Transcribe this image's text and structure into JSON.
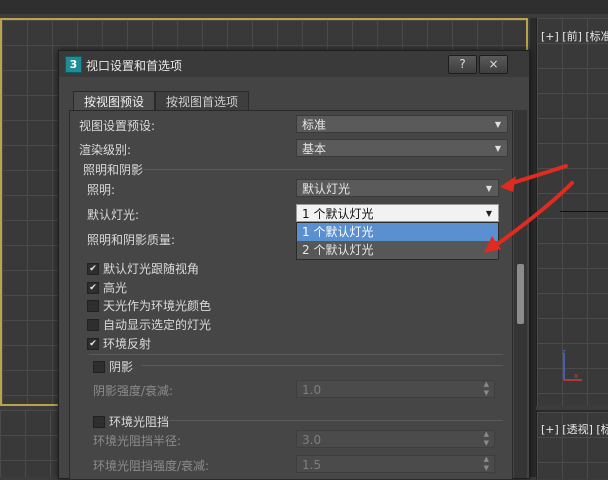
{
  "viewports": {
    "top_right_label": "[+] [前] [标准",
    "bottom_right_label": "[+] [透视] [标"
  },
  "dialog": {
    "title": "视口设置和首选项",
    "app_icon_text": "3",
    "help_button": "?",
    "close_button": "×",
    "tabs": [
      "按视图预设",
      "按视图首选项"
    ],
    "rows": {
      "preset_label": "视图设置预设:",
      "preset_value": "标准",
      "render_label": "渲染级别:",
      "render_value": "基本",
      "section_lighting": "照明和阴影",
      "lighting_label": "照明:",
      "lighting_value": "默认灯光",
      "default_light_label": "默认灯光:",
      "default_light_value": "1 个默认灯光",
      "quality_label": "照明和阴影质量:"
    },
    "dropdown_options": [
      "1 个默认灯光",
      "2 个默认灯光"
    ],
    "checkboxes": [
      {
        "label": "默认灯光跟随视角",
        "checked": "✔"
      },
      {
        "label": "高光",
        "checked": "✔"
      },
      {
        "label": "天光作为环境光颜色",
        "checked": ""
      },
      {
        "label": "自动显示选定的灯光",
        "checked": ""
      },
      {
        "label": "环境反射",
        "checked": "✔"
      }
    ],
    "shadow": {
      "title": "阴影",
      "strength_label": "阴影强度/衰减:",
      "strength_value": "1.0"
    },
    "ao": {
      "title": "环境光阻挡",
      "radius_label": "环境光阻挡半径:",
      "radius_value": "3.0",
      "strength_label": "环境光阻挡强度/衰减:",
      "strength_value": "1.5"
    }
  },
  "colors": {
    "accent_arrow": "#e02b20",
    "selection": "#5a8fd0"
  }
}
